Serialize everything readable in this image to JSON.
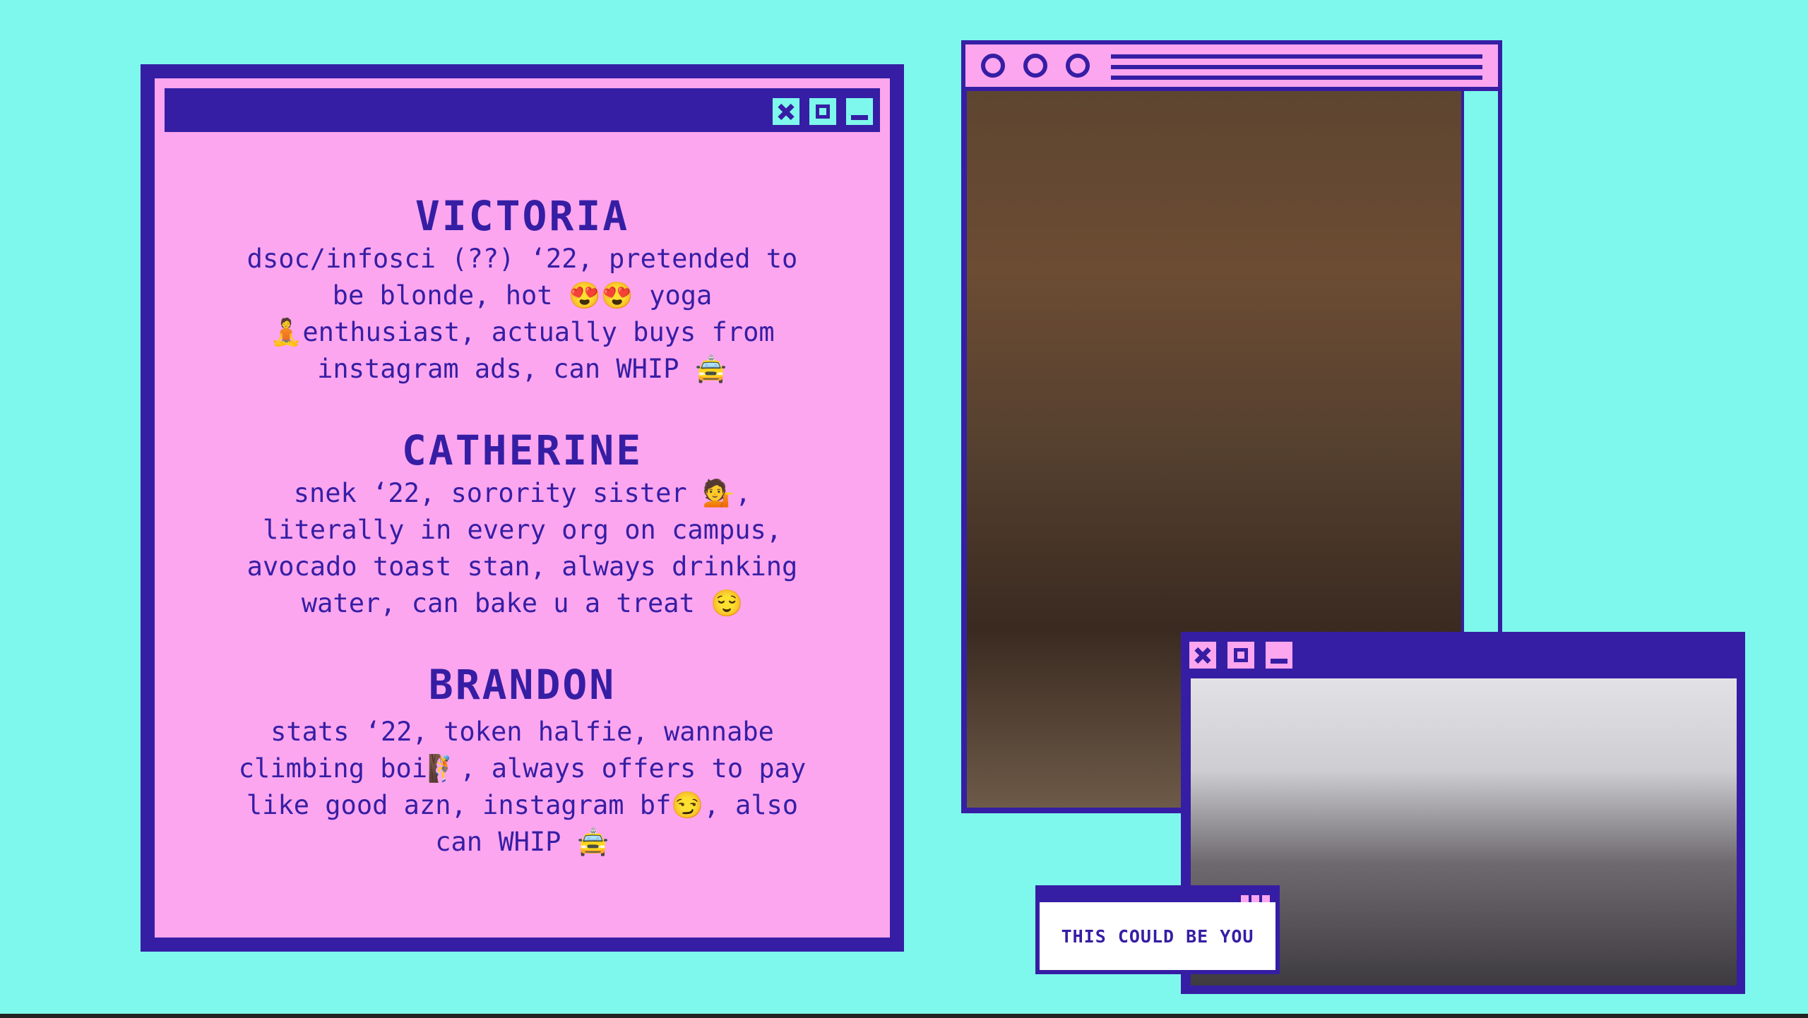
{
  "colors": {
    "background": "#7ef8ec",
    "window_frame": "#361ea4",
    "window_fill": "#fba6ef",
    "popup_fill": "#ffffff"
  },
  "bios": [
    {
      "name": "VICTORIA",
      "lines": [
        "dsoc/infosci (??) ‘22, pretended to",
        "be blonde, hot 😍😍 yoga",
        "🧘enthusiast, actually buys from",
        "instagram ads, can WHIP 🚖"
      ]
    },
    {
      "name": "CATHERINE",
      "lines": [
        "snek ‘22, sorority sister 💁,",
        "literally in every org on campus,",
        "avocado toast stan, always drinking",
        "water, can bake u a treat 😌"
      ]
    },
    {
      "name": "BRANDON",
      "lines": [
        "stats ‘22, token halfie, wannabe",
        "climbing boi🧗, always offers to pay",
        "like good azn, instagram bf😏, also",
        "can WHIP 🚖"
      ]
    }
  ],
  "popup": {
    "text": "THIS COULD BE YOU"
  },
  "icons": [
    "close-icon",
    "maximize-icon",
    "minimize-icon",
    "circle-button-icon"
  ]
}
